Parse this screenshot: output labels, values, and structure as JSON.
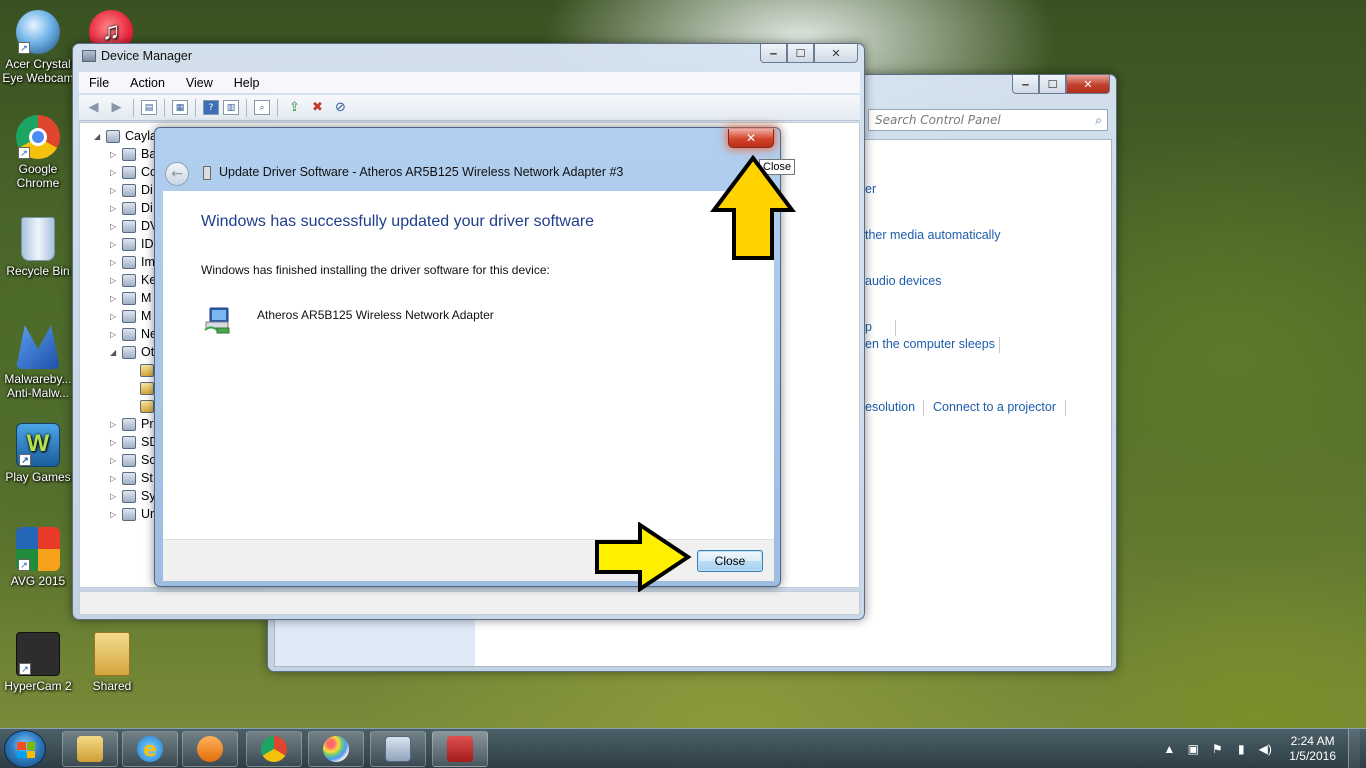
{
  "desktop_icons": [
    {
      "label": "Acer Crystal Eye Webcam",
      "color": "#6fb3e8"
    },
    {
      "label": "Google Chrome",
      "color": "#e0452e"
    },
    {
      "label": "Recycle Bin",
      "color": "#c9dbec"
    },
    {
      "label": "Malwareby... Anti-Malw...",
      "color": "#2a67c6"
    },
    {
      "label": "Play Games",
      "color": "#2e82c9"
    },
    {
      "label": "AVG 2015",
      "color": "#f08a1c"
    },
    {
      "label": "HyperCam 2",
      "color": "#2d2d2d"
    },
    {
      "label": "Shared",
      "color": "#e2bf5a"
    }
  ],
  "control_panel": {
    "search_placeholder": "Search Control Panel",
    "links": {
      "l1": "er",
      "l2": "ther media automatically",
      "l3": "audio devices",
      "l4": "p",
      "l5": "en the computer sleeps",
      "l6": "esolution",
      "l7": "Connect to a projector"
    }
  },
  "device_manager": {
    "title": "Device Manager",
    "menu": [
      "File",
      "Action",
      "View",
      "Help"
    ],
    "root": "Cayla",
    "tree_items": [
      "Ba",
      "Co",
      "Di",
      "Di",
      "DV",
      "ID",
      "Im",
      "Ke",
      "M",
      "M",
      "Ne",
      "Ot",
      "",
      "",
      "",
      "Pr",
      "SD",
      "So",
      "St",
      "Sy",
      "Ur"
    ]
  },
  "dialog": {
    "title": "Update Driver Software - Atheros AR5B125 Wireless Network Adapter #3",
    "main_message": "Windows has successfully updated your driver software",
    "sub_message": "Windows has finished installing the driver software for this device:",
    "device_name": "Atheros AR5B125 Wireless Network Adapter",
    "close_button": "Close",
    "close_x": "✕"
  },
  "tooltip": "Close",
  "taskbar": {
    "time": "2:24 AM",
    "date": "1/5/2016"
  },
  "colors": {
    "annotation_arrow": "#ffd200",
    "link": "#1e5dab",
    "heading": "#1e3f8a"
  }
}
